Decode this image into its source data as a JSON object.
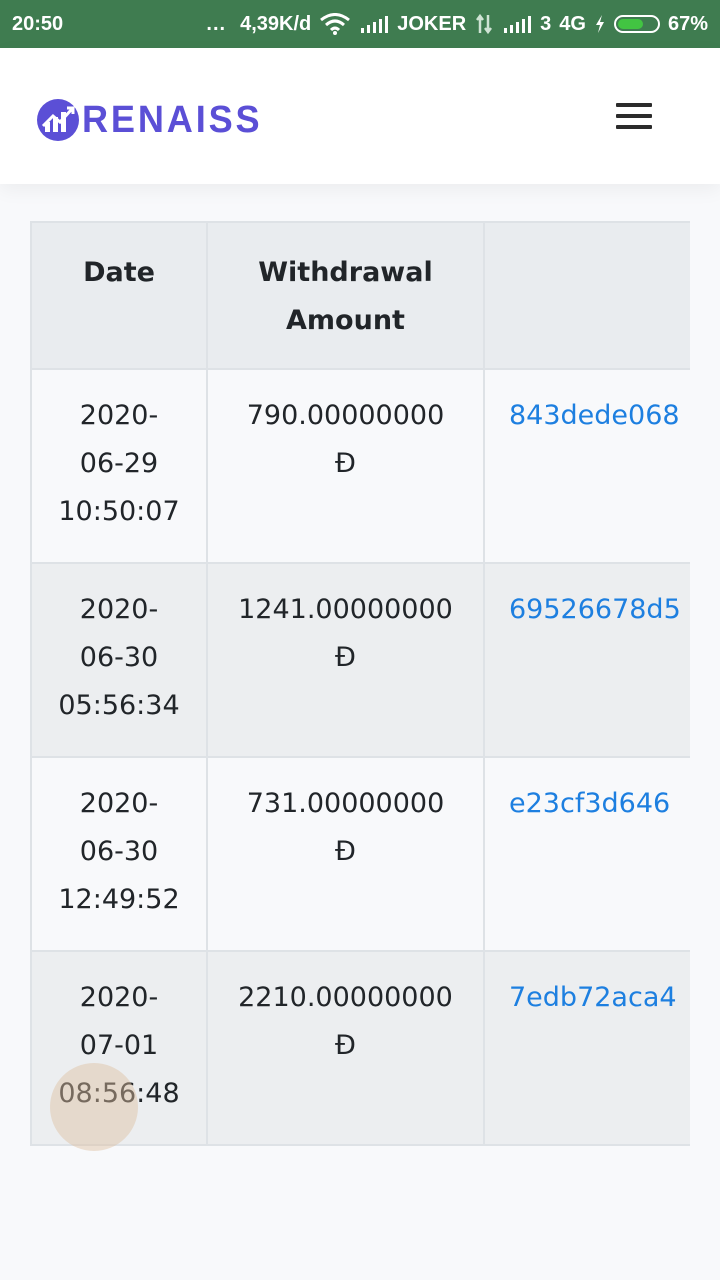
{
  "status_bar": {
    "time": "20:50",
    "dots": "...",
    "speed": "4,39K/d",
    "carrier": "JOKER",
    "sim": "3",
    "network": "4G",
    "battery_percent_label": "67%",
    "battery_level": 0.67
  },
  "header": {
    "logo_text": "RENAISS",
    "brand_color": "#5b4fd6"
  },
  "table": {
    "headers": {
      "date": "Date",
      "amount_line1": "Withdrawal",
      "amount_line2": "Amount",
      "tx": ""
    },
    "rows": [
      {
        "date_line1": "2020-",
        "date_line2": "06-29",
        "date_line3": "10:50:07",
        "amount": "790.00000000",
        "currency": "Đ",
        "tx": "843dede068"
      },
      {
        "date_line1": "2020-",
        "date_line2": "06-30",
        "date_line3": "05:56:34",
        "amount": "1241.00000000",
        "currency": "Đ",
        "tx": "69526678d5"
      },
      {
        "date_line1": "2020-",
        "date_line2": "06-30",
        "date_line3": "12:49:52",
        "amount": "731.00000000",
        "currency": "Đ",
        "tx": "e23cf3d646"
      },
      {
        "date_line1": "2020-",
        "date_line2": "07-01",
        "date_line3": "08:56:48",
        "amount": "2210.00000000",
        "currency": "Đ",
        "tx": "7edb72aca4"
      }
    ]
  },
  "colors": {
    "status_bar": "#3f7c50",
    "link": "#1d7fe0",
    "header_cell": "#e9ecef",
    "row_striped": "#eceef0"
  }
}
